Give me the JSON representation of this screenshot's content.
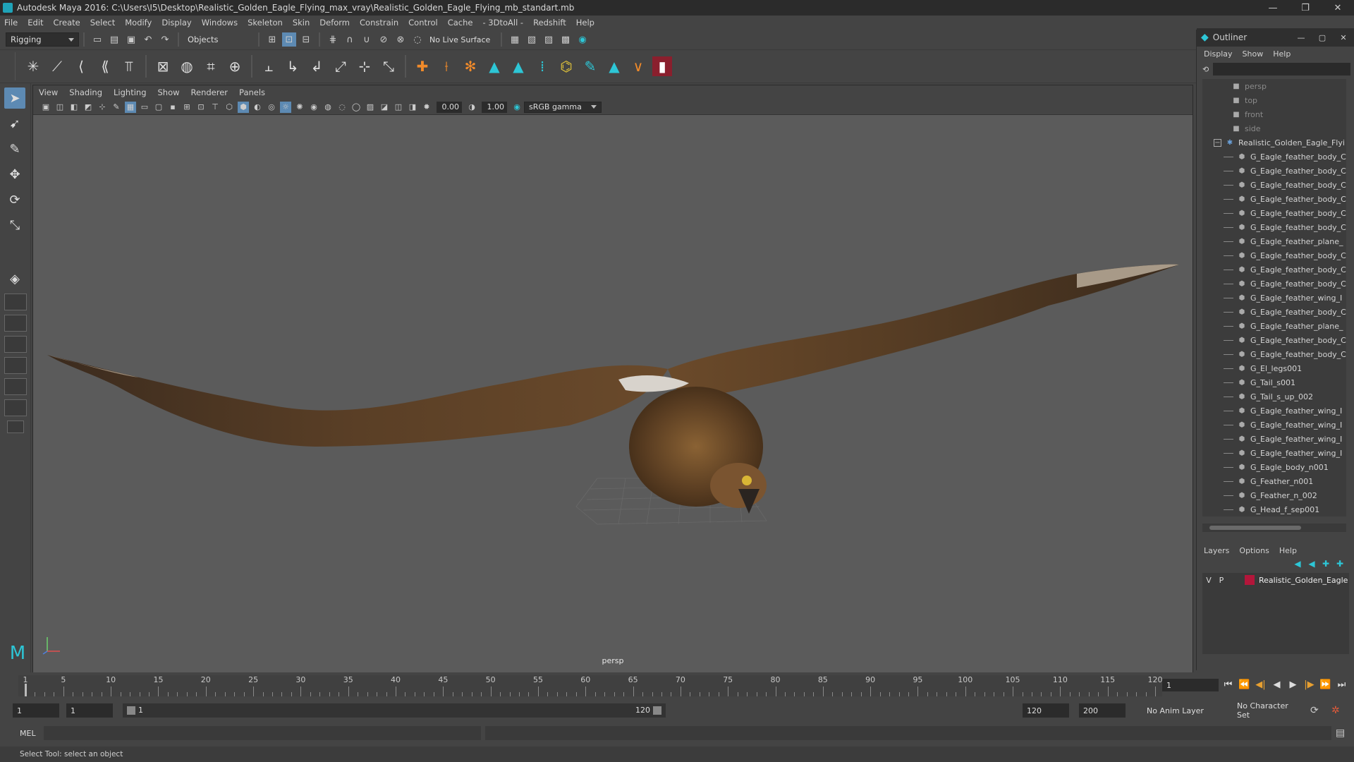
{
  "window": {
    "title": "Autodesk Maya 2016: C:\\Users\\I5\\Desktop\\Realistic_Golden_Eagle_Flying_max_vray\\Realistic_Golden_Eagle_Flying_mb_standart.mb",
    "minimize": "—",
    "maximize": "❐",
    "close": "✕"
  },
  "menubar": [
    "File",
    "Edit",
    "Create",
    "Select",
    "Modify",
    "Display",
    "Windows",
    "Skeleton",
    "Skin",
    "Deform",
    "Constrain",
    "Control",
    "Cache",
    "- 3DtoAll -",
    "Redshift",
    "Help"
  ],
  "statusline": {
    "menuset": "Rigging",
    "selection_mode": "Objects",
    "live_surface": "No Live Surface"
  },
  "viewport": {
    "menu": [
      "View",
      "Shading",
      "Lighting",
      "Show",
      "Renderer",
      "Panels"
    ],
    "exposure": "0.00",
    "gamma": "1.00",
    "color_space": "sRGB gamma",
    "camera_label": "persp"
  },
  "outliner": {
    "title": "Outliner",
    "menu": [
      "Display",
      "Show",
      "Help"
    ],
    "cameras": [
      "persp",
      "top",
      "front",
      "side"
    ],
    "root": "Realistic_Golden_Eagle_Flyi",
    "children": [
      "G_Eagle_feather_body_C",
      "G_Eagle_feather_body_C",
      "G_Eagle_feather_body_C",
      "G_Eagle_feather_body_C",
      "G_Eagle_feather_body_C",
      "G_Eagle_feather_body_C",
      "G_Eagle_feather_plane_",
      "G_Eagle_feather_body_C",
      "G_Eagle_feather_body_C",
      "G_Eagle_feather_body_C",
      "G_Eagle_feather_wing_I",
      "G_Eagle_feather_body_C",
      "G_Eagle_feather_plane_",
      "G_Eagle_feather_body_C",
      "G_Eagle_feather_body_C",
      "G_El_legs001",
      "G_Tail_s001",
      "G_Tail_s_up_002",
      "G_Eagle_feather_wing_I",
      "G_Eagle_feather_wing_I",
      "G_Eagle_feather_wing_I",
      "G_Eagle_feather_wing_I",
      "G_Eagle_body_n001",
      "G_Feather_n001",
      "G_Feather_n_002",
      "G_Head_f_sep001"
    ]
  },
  "layers": {
    "menu": [
      "Layers",
      "Options",
      "Help"
    ],
    "rows": [
      {
        "v": "V",
        "p": "P",
        "name": "Realistic_Golden_Eagle",
        "color": "#b3163a"
      }
    ]
  },
  "timeslider": {
    "ticks": [
      1,
      5,
      10,
      15,
      20,
      25,
      30,
      35,
      40,
      45,
      50,
      55,
      60,
      65,
      70,
      75,
      80,
      85,
      90,
      95,
      100,
      105,
      110,
      115,
      120
    ],
    "min": 1,
    "max": 120,
    "current_frame": "1"
  },
  "rangeslider": {
    "start": "1",
    "anim_start": "1",
    "range_start_label": "1",
    "range_end_label": "120",
    "anim_end": "120",
    "end": "200",
    "anim_layer": "No Anim Layer",
    "character_set": "No Character Set"
  },
  "cmdline": {
    "label": "MEL"
  },
  "helpline": {
    "text": "Select Tool: select an object"
  }
}
